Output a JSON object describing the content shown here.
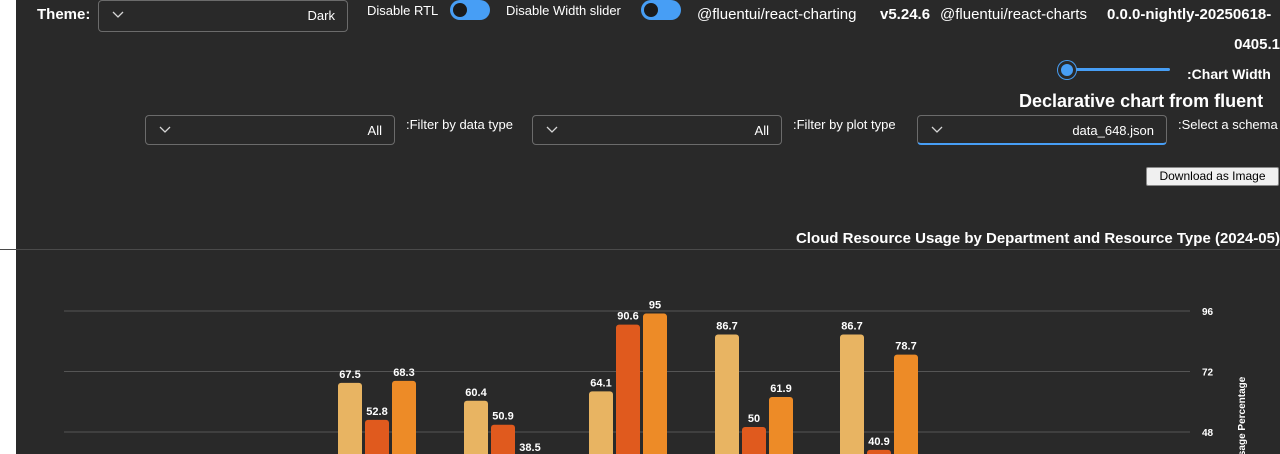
{
  "theme": {
    "label": "Theme:",
    "value": "Dark"
  },
  "toggles": {
    "rtl_label": "Disable RTL",
    "width_slider_label": "Disable Width slider"
  },
  "packages": {
    "charting_name": "@fluentui/react-charting",
    "charting_version": "v5.24.6",
    "charts_name": "@fluentui/react-charts",
    "charts_version_line1": "0.0.0-nightly-20250618-",
    "charts_version_line2": "0405.1"
  },
  "chart_width": {
    "label": ":Chart Width"
  },
  "declarative_title": "Declarative chart from fluent",
  "filters": {
    "data_type_value": "All",
    "data_type_label": ":Filter by data type",
    "plot_type_value": "All",
    "plot_type_label": ":Filter by plot type",
    "schema_value": "data_648.json",
    "schema_label": ":Select a schema"
  },
  "download_button": "Download as Image",
  "colors": {
    "accent": "#479ef5",
    "bar1": "#e8b462",
    "bar2": "#e05a1e",
    "bar3": "#ed8b27"
  },
  "chart_data": {
    "type": "bar",
    "title": "Cloud Resource Usage by Department and Resource Type (2024-05)",
    "ylabel": "Usage Percentage",
    "ylim": [
      0,
      96
    ],
    "yticks": [
      48,
      72,
      96
    ],
    "groups": [
      {
        "values": [
          67.5,
          52.8,
          68.3
        ]
      },
      {
        "values": [
          60.4,
          50.9,
          38.5
        ]
      },
      {
        "values": [
          64.1,
          90.6,
          95
        ]
      },
      {
        "values": [
          86.7,
          50,
          61.9
        ]
      },
      {
        "values": [
          86.7,
          40.9,
          78.7
        ]
      }
    ]
  }
}
